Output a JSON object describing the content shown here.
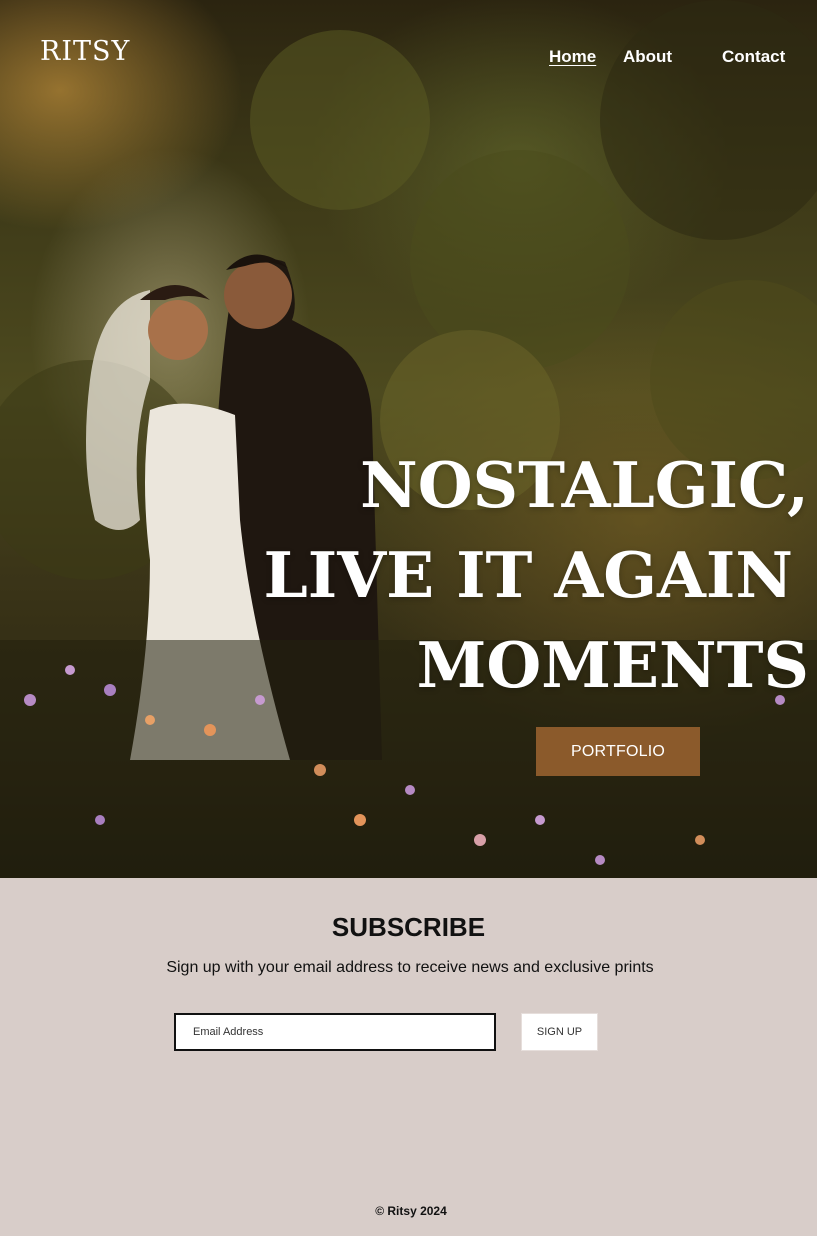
{
  "brand": "RITSY",
  "nav": {
    "home": "Home",
    "about": "About",
    "contact": "Contact"
  },
  "hero": {
    "headline_line1": "NOSTALGIC,",
    "headline_line2": "LIVE IT AGAIN",
    "headline_line3": "MOMENTS",
    "portfolio_label": "PORTFOLIO",
    "image_subject": "bride-and-groom-in-meadow"
  },
  "subscribe": {
    "title": "SUBSCRIBE",
    "text": "Sign up with your email address to receive news and exclusive prints",
    "email_placeholder": "Email Address",
    "button_label": "SIGN UP"
  },
  "footer": {
    "copyright": "© Ritsy 2024"
  },
  "colors": {
    "accent": "#8b5a2b",
    "page_background": "#d8cdc9",
    "text": "#111111"
  }
}
